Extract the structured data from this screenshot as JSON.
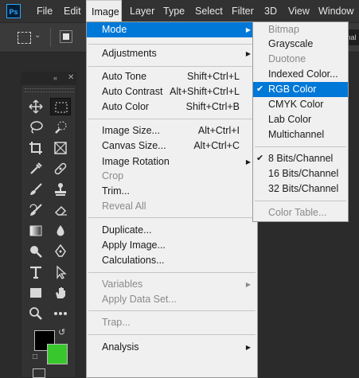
{
  "app": {
    "logo_text": "Ps"
  },
  "menubar": {
    "items": [
      "File",
      "Edit",
      "Image",
      "Layer",
      "Type",
      "Select",
      "Filter",
      "3D",
      "View",
      "Window"
    ],
    "active_item": "Image"
  },
  "optionsbar": {
    "right_partial_text": "mal"
  },
  "image_menu": {
    "mode": "Mode",
    "adjustments": "Adjustments",
    "auto_tone": {
      "label": "Auto Tone",
      "shortcut": "Shift+Ctrl+L"
    },
    "auto_contrast": {
      "label": "Auto Contrast",
      "shortcut": "Alt+Shift+Ctrl+L"
    },
    "auto_color": {
      "label": "Auto Color",
      "shortcut": "Shift+Ctrl+B"
    },
    "image_size": {
      "label": "Image Size...",
      "shortcut": "Alt+Ctrl+I"
    },
    "canvas_size": {
      "label": "Canvas Size...",
      "shortcut": "Alt+Ctrl+C"
    },
    "image_rotation": "Image Rotation",
    "crop": "Crop",
    "trim": "Trim...",
    "reveal_all": "Reveal All",
    "duplicate": "Duplicate...",
    "apply_image": "Apply Image...",
    "calculations": "Calculations...",
    "variables": "Variables",
    "apply_data_set": "Apply Data Set...",
    "trap": "Trap...",
    "analysis": "Analysis"
  },
  "mode_submenu": {
    "bitmap": "Bitmap",
    "grayscale": "Grayscale",
    "duotone": "Duotone",
    "indexed_color": "Indexed Color...",
    "rgb_color": "RGB Color",
    "cmyk_color": "CMYK Color",
    "lab_color": "Lab Color",
    "multichannel": "Multichannel",
    "bits_8": "8 Bits/Channel",
    "bits_16": "16 Bits/Channel",
    "bits_32": "32 Bits/Channel",
    "color_table": "Color Table...",
    "checked_mode": "RGB Color",
    "checked_depth": "8 Bits/Channel"
  },
  "colors": {
    "foreground": "#000000",
    "background": "#38c82d",
    "highlight": "#0078d7",
    "menubar": "#323232"
  },
  "tools": [
    "move-tool",
    "rectangular-marquee-tool",
    "lasso-tool",
    "quick-selection-tool",
    "crop-tool",
    "frame-tool",
    "eyedropper-tool",
    "spot-healing-brush-tool",
    "brush-tool",
    "clone-stamp-tool",
    "history-brush-tool",
    "eraser-tool",
    "gradient-tool",
    "blur-tool",
    "dodge-tool",
    "pen-tool",
    "type-tool",
    "path-selection-tool",
    "zoom-tool",
    "edit-toolbar"
  ]
}
